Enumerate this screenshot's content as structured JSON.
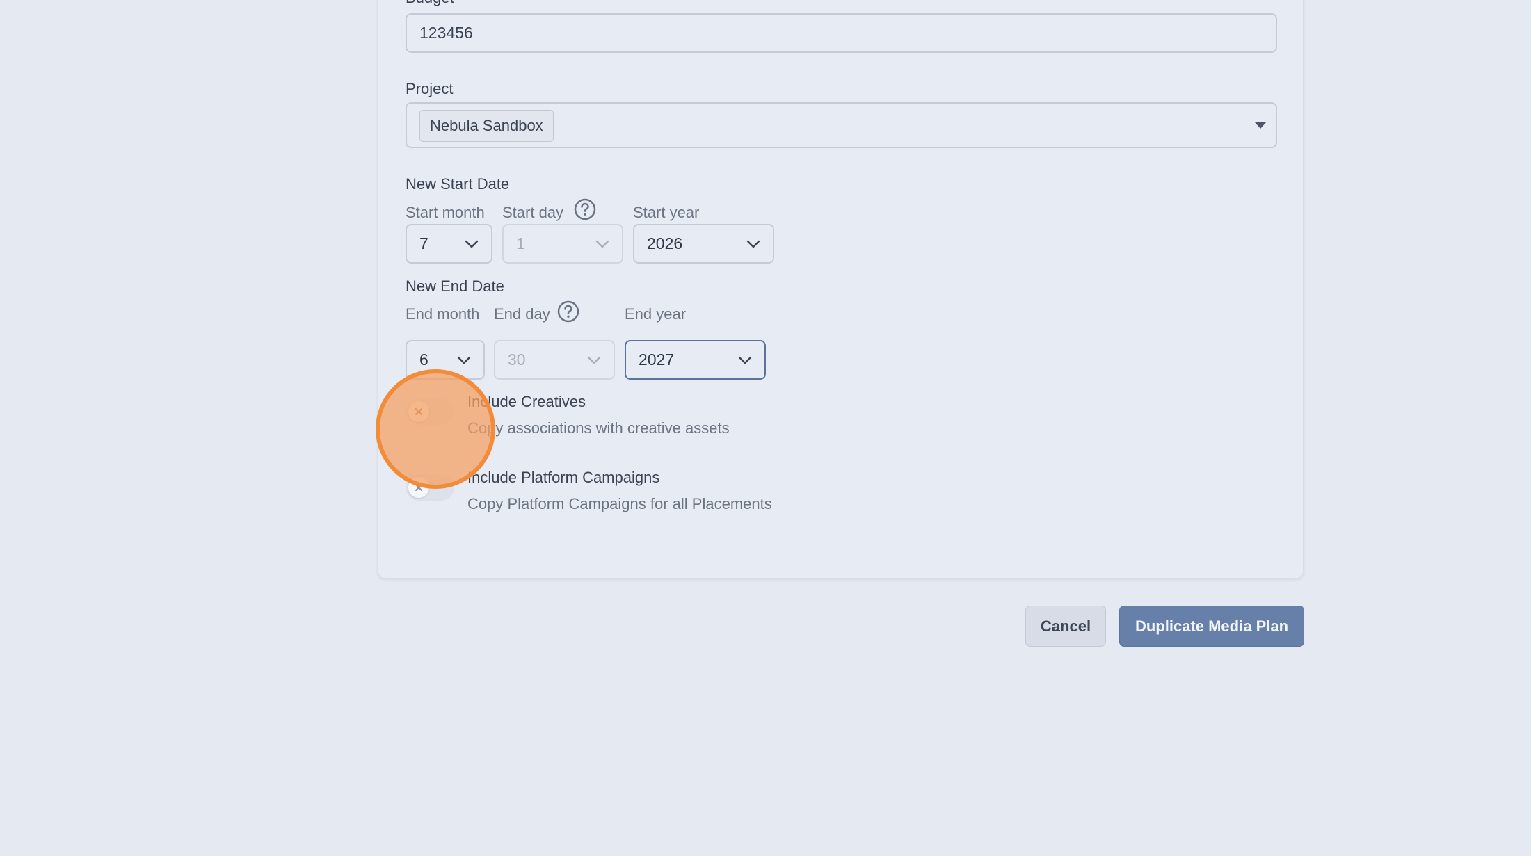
{
  "form": {
    "budget": {
      "label": "Budget",
      "value": "123456"
    },
    "project": {
      "label": "Project",
      "selected_chip": "Nebula Sandbox"
    },
    "start_date": {
      "heading": "New Start Date",
      "month_label": "Start month",
      "day_label": "Start day",
      "year_label": "Start year",
      "month_value": "7",
      "day_value": "1",
      "year_value": "2026"
    },
    "end_date": {
      "heading": "New End Date",
      "month_label": "End month",
      "day_label": "End day",
      "year_label": "End year",
      "month_value": "6",
      "day_value": "30",
      "year_value": "2027"
    },
    "include_creatives": {
      "title": "Include Creatives",
      "description": "Copy associations with creative assets",
      "enabled": false
    },
    "include_platform_campaigns": {
      "title": "Include Platform Campaigns",
      "description": "Copy Platform Campaigns for all Placements",
      "enabled": false
    }
  },
  "actions": {
    "cancel_label": "Cancel",
    "submit_label": "Duplicate Media Plan"
  },
  "icons": {
    "help": "question-circle-icon",
    "chevron": "chevron-down-icon",
    "caret": "caret-down-icon",
    "toggle_off": "x-icon"
  },
  "colors": {
    "page_background": "#e5e9f1",
    "primary_button": "#6680aa",
    "focus_border": "#5d739a",
    "click_indicator": "#f38c3a"
  }
}
